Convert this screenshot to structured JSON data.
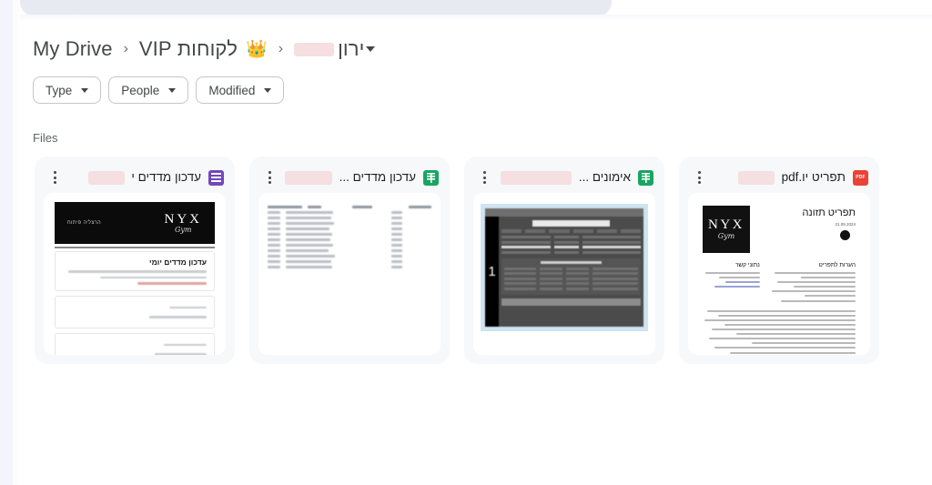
{
  "breadcrumb": {
    "root": "My Drive",
    "separator": "›",
    "vip_crown_icon": "crown-icon",
    "vip_label": "לקוחות VIP",
    "current": "ירון",
    "current_redacted": true,
    "dropdown_icon": "caret-down-icon"
  },
  "filters": [
    {
      "label": "Type",
      "icon": "chevron-down-icon"
    },
    {
      "label": "People",
      "icon": "chevron-down-icon"
    },
    {
      "label": "Modified",
      "icon": "chevron-down-icon"
    }
  ],
  "section": {
    "label": "Files"
  },
  "files": [
    {
      "title": "עדכון מדדים י",
      "icon": "google-forms-icon",
      "type": "form",
      "menu_icon": "kebab-menu-icon",
      "preview": {
        "banner_brand": "NYX",
        "banner_script": "Gym",
        "banner_hebrew": "הרצליה פיתוח",
        "form_heading": "עדכון מדדים יומי"
      }
    },
    {
      "title": "עדכון מדדים ...",
      "icon": "google-sheets-icon",
      "type": "spreadsheet",
      "menu_icon": "kebab-menu-icon",
      "preview": {
        "rows": 12,
        "columns": 4
      }
    },
    {
      "title": "אימונים ...",
      "icon": "google-sheets-icon",
      "type": "spreadsheet",
      "menu_icon": "kebab-menu-icon",
      "preview": {
        "rail_text": "1"
      }
    },
    {
      "title": "תפריט יו.pdf",
      "icon": "pdf-icon",
      "icon_label": "PDF",
      "type": "pdf",
      "menu_icon": "kebab-menu-icon",
      "preview": {
        "doc_title": "תפריט תזונה",
        "doc_date": "21.05.2024",
        "brand": "NYX",
        "brand_script": "Gym",
        "section_right": "הערות לתפריט",
        "section_left": "נתוני קשר"
      }
    }
  ],
  "colors": {
    "forms_purple": "#7248b9",
    "sheets_green": "#1aa463",
    "pdf_red": "#ea4335",
    "card_bg": "#f6f8fa",
    "text_primary": "#1f1f1f",
    "text_secondary": "#444746",
    "redaction": "#f6dfe0"
  }
}
